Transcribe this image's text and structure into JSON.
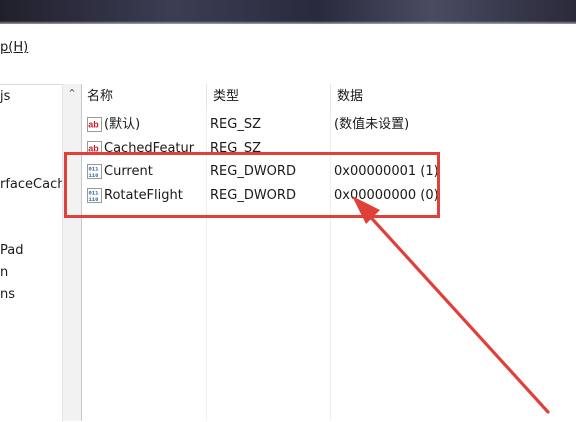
{
  "menu": {
    "help_prefix": "p",
    "help_underlined": "(H)"
  },
  "tree": {
    "items": [
      "js",
      "rfaceCach",
      "Pad",
      "n",
      "ns"
    ]
  },
  "columns": {
    "name": "名称",
    "type": "类型",
    "data": "数据"
  },
  "rows": [
    {
      "icon": "string-value-icon",
      "name": "(默认)",
      "type": "REG_SZ",
      "data": "(数值未设置)"
    },
    {
      "icon": "string-value-icon",
      "name": "CachedFeatur",
      "type": "REG_SZ",
      "data": ""
    },
    {
      "icon": "dword-value-icon",
      "name": "Current",
      "type": "REG_DWORD",
      "data": "0x00000001 (1)"
    },
    {
      "icon": "dword-value-icon",
      "name": "RotateFlight",
      "type": "REG_DWORD",
      "data": "0x00000000 (0)"
    }
  ],
  "colors": {
    "annotation_red": "#e0403a",
    "string_icon_red": "#c8202a",
    "dword_icon_blue": "#2f5ea8"
  }
}
